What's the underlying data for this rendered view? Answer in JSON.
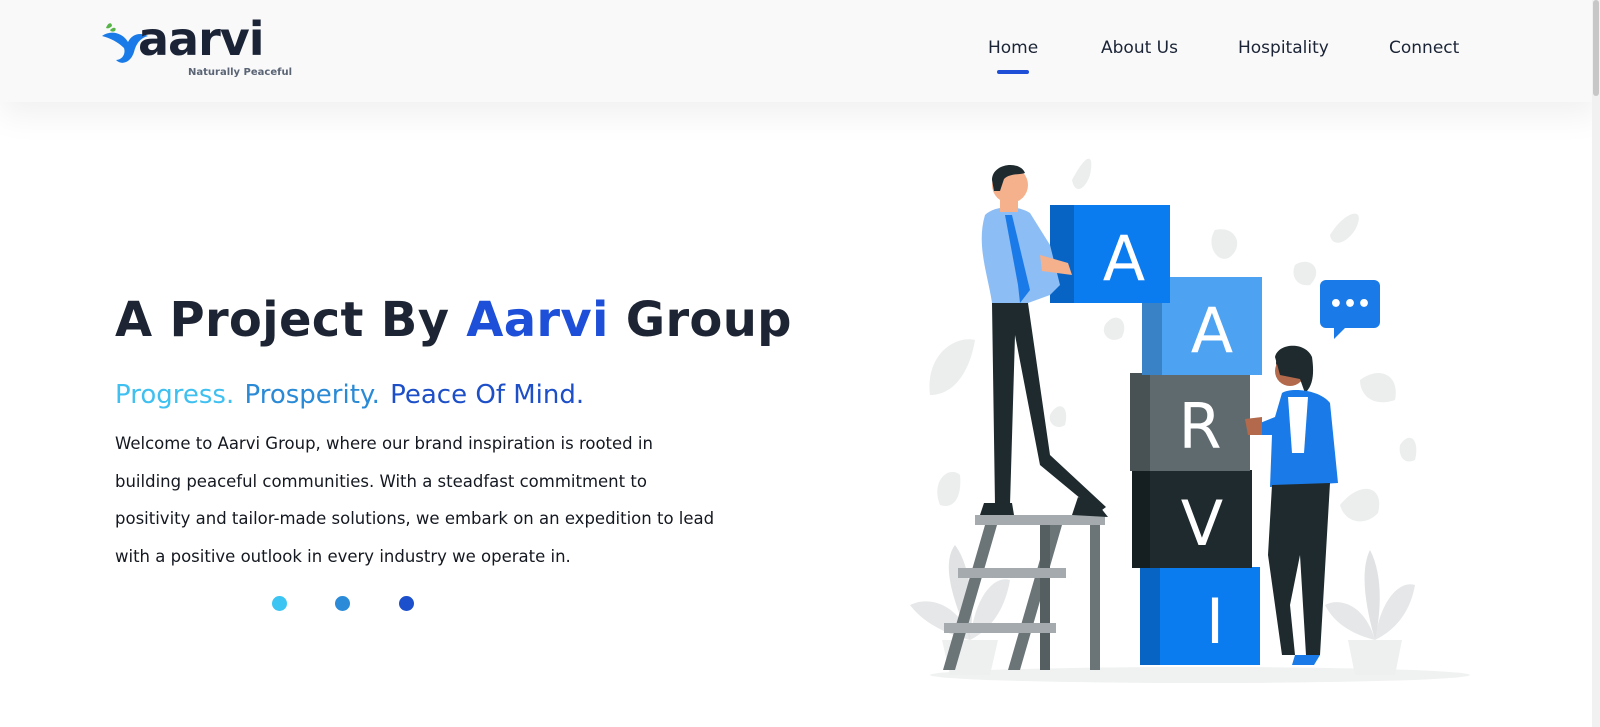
{
  "logo": {
    "wordmark": "aarvi",
    "tagline": "Naturally Peaceful"
  },
  "nav": {
    "items": [
      {
        "label": "Home",
        "active": true
      },
      {
        "label": "About Us",
        "active": false
      },
      {
        "label": "Hospitality",
        "active": false
      },
      {
        "label": "Connect",
        "active": false
      }
    ]
  },
  "hero": {
    "title_prefix": "A Project By",
    "title_brand": "Aarvi",
    "title_suffix": "Group",
    "tagline": [
      "Progress.",
      "Prosperity.",
      "Peace Of Mind."
    ],
    "description": "Welcome to Aarvi Group, where our brand inspiration is rooted in building peaceful communities. With a steadfast commitment to positivity and tailor-made solutions, we embark on an expedition to lead with a positive outlook in every industry we operate in.",
    "dot_colors": [
      "#3cc4f2",
      "#2b8bd8",
      "#1c4fcb"
    ]
  },
  "illustration": {
    "blocks": [
      "A",
      "A",
      "R",
      "V",
      "I"
    ],
    "speech_bubble": "•••"
  },
  "colors": {
    "brand_blue": "#1d4fd8",
    "block_blue": "#0a7cf0",
    "block_light_blue": "#4da3f2",
    "block_gray": "#5f6a6f",
    "block_dark": "#1e2a2e",
    "nav_underline": "#1f4fd6"
  }
}
